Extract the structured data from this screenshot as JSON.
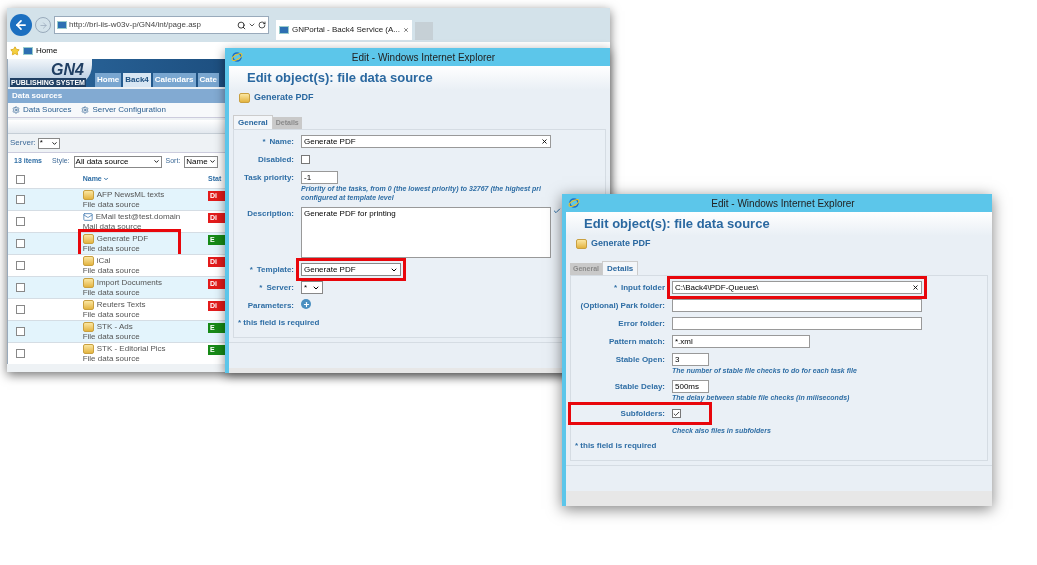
{
  "browser": {
    "address": "http://bri-iis-w03v-p/GN4/int/page.asp",
    "tab_title": "GNPortal - Back4 Service (A...",
    "favorite": "Home"
  },
  "portal": {
    "logo": "GN4",
    "logo_sub": "PUBLISHING SYSTEM",
    "nav_tabs": [
      {
        "label": "Home",
        "selected": false
      },
      {
        "label": "Back4",
        "selected": true
      },
      {
        "label": "Calendars",
        "selected": false
      },
      {
        "label": "Cate",
        "selected": false
      }
    ],
    "section_title": "Data sources",
    "toolbar": [
      "Data Sources",
      "Server Configuration"
    ],
    "server_label": "Server:",
    "server_value": "*",
    "item_count": "13 items",
    "style_label": "Style:",
    "style_value": "All data source",
    "sort_label": "Sort:",
    "sort_value": "Name",
    "all_checked": false,
    "columns": [
      {
        "label": "Name",
        "sorted": true
      },
      {
        "label": "Stat",
        "sorted": false
      }
    ],
    "rows": [
      {
        "kind": "file",
        "name": "AFP NewsML texts",
        "type": "File data source",
        "status": "Di",
        "color": "#e31b1b",
        "checked": false,
        "highlight": false
      },
      {
        "kind": "mail",
        "name": "EMail test@test.domain",
        "type": "Mail data source",
        "status": "Di",
        "color": "#e31b1b",
        "checked": false,
        "highlight": false
      },
      {
        "kind": "file",
        "name": "Generate PDF",
        "type": "File data source",
        "status": "E",
        "color": "#178a17",
        "checked": false,
        "highlight": true
      },
      {
        "kind": "file",
        "name": "iCal",
        "type": "File data source",
        "status": "Di",
        "color": "#e31b1b",
        "checked": false,
        "highlight": false
      },
      {
        "kind": "file",
        "name": "Import Documents",
        "type": "File data source",
        "status": "Di",
        "color": "#e31b1b",
        "checked": false,
        "highlight": false
      },
      {
        "kind": "file",
        "name": "Reuters Texts",
        "type": "File data source",
        "status": "Di",
        "color": "#e31b1b",
        "checked": false,
        "highlight": false
      },
      {
        "kind": "file",
        "name": "STK - Ads",
        "type": "File data source",
        "status": "E",
        "color": "#178a17",
        "checked": false,
        "highlight": false
      },
      {
        "kind": "file",
        "name": "STK - Editorial Pics",
        "type": "File data source",
        "status": "E",
        "color": "#178a17",
        "checked": false,
        "highlight": false
      }
    ]
  },
  "dialog_general": {
    "title": "Edit - Windows Internet Explorer",
    "heading": "Edit object(s): file data source",
    "object": "Generate PDF",
    "tabs": [
      {
        "label": "General",
        "selected": true
      },
      {
        "label": "Details",
        "selected": false
      }
    ],
    "fields": [
      {
        "kind": "text",
        "mark": "*",
        "label": "Name:",
        "value": "Generate PDF",
        "highlight": false
      },
      {
        "kind": "checkbox",
        "label": "Disabled:",
        "checked": false,
        "highlight": false
      },
      {
        "kind": "short",
        "label": "Task priority:",
        "value": "-1",
        "hint_lines": [
          "Priority of the tasks, from 0 (the lowest priority) to 32767 (the highest pri",
          "configured at template level"
        ],
        "highlight": false
      },
      {
        "kind": "textarea",
        "label": "Description:",
        "value": "Generate PDF for printing",
        "highlight": false
      },
      {
        "kind": "select",
        "mark": "*",
        "label": "Template:",
        "value": "Generate PDF",
        "highlight": true
      },
      {
        "kind": "smallselect",
        "mark": "*",
        "label": "Server:",
        "value": "*",
        "highlight": false
      },
      {
        "kind": "add",
        "label": "Parameters:",
        "highlight": false
      }
    ],
    "required_note": "* this field is required"
  },
  "dialog_details": {
    "title": "Edit - Windows Internet Explorer",
    "heading": "Edit object(s): file data source",
    "object": "Generate PDF",
    "tabs": [
      {
        "label": "General",
        "selected": false
      },
      {
        "label": "Details",
        "selected": true
      }
    ],
    "fields": [
      {
        "kind": "text",
        "mark": "*",
        "label": "Input folder",
        "value": "C:\\Back4\\PDF-Queues\\",
        "highlight": true
      },
      {
        "kind": "text",
        "label": "(Optional) Park folder:",
        "highlight": false
      },
      {
        "kind": "text",
        "label": "Error folder:",
        "highlight": false
      },
      {
        "kind": "medium",
        "label": "Pattern match:",
        "value": "*.xml",
        "highlight": false
      },
      {
        "kind": "short",
        "label": "Stable Open:",
        "value": "3",
        "hint_lines": [
          "The number of stable file checks to do for each task file"
        ],
        "highlight": false
      },
      {
        "kind": "short",
        "label": "Stable Delay:",
        "value": "500ms",
        "hint_lines": [
          "The delay between stable file checks (in miliseconds)"
        ],
        "highlight": false
      },
      {
        "kind": "checkbox",
        "label": "Subfolders:",
        "checked": true,
        "hint_lines": [
          "Check also files in subfolders"
        ],
        "highlight": true
      }
    ],
    "required_note": "* this field is required"
  }
}
